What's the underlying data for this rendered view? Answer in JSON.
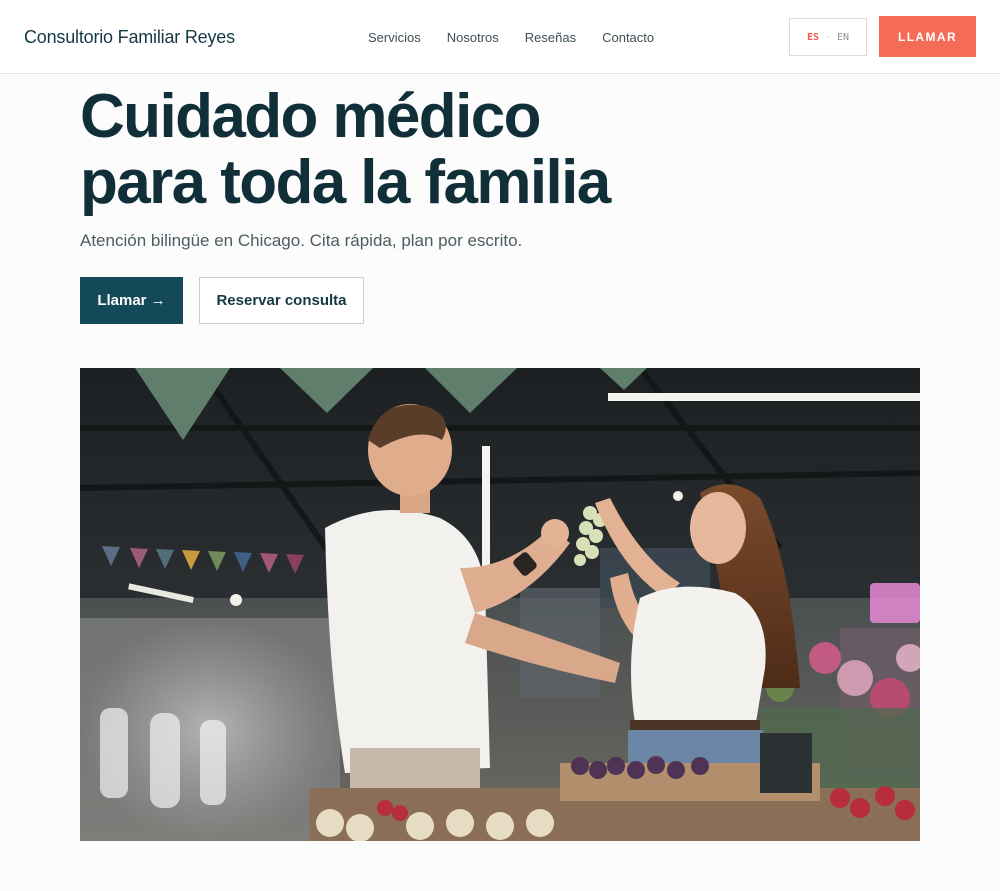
{
  "header": {
    "brand": "Consultorio Familiar Reyes",
    "nav": [
      "Servicios",
      "Nosotros",
      "Reseñas",
      "Contacto"
    ],
    "lang": {
      "es": "ES",
      "en": "EN"
    },
    "call": "LLAMAR"
  },
  "hero": {
    "title_line1": "Cuidado médico",
    "title_line2": "para toda la familia",
    "subtitle": "Atención bilingüe en Chicago. Cita rápida, plan por escrito.",
    "primary_button": "Llamar →",
    "secondary_button": "Reservar consulta"
  },
  "colors": {
    "brand_dark": "#14495a",
    "accent_coral": "#f46c55"
  }
}
